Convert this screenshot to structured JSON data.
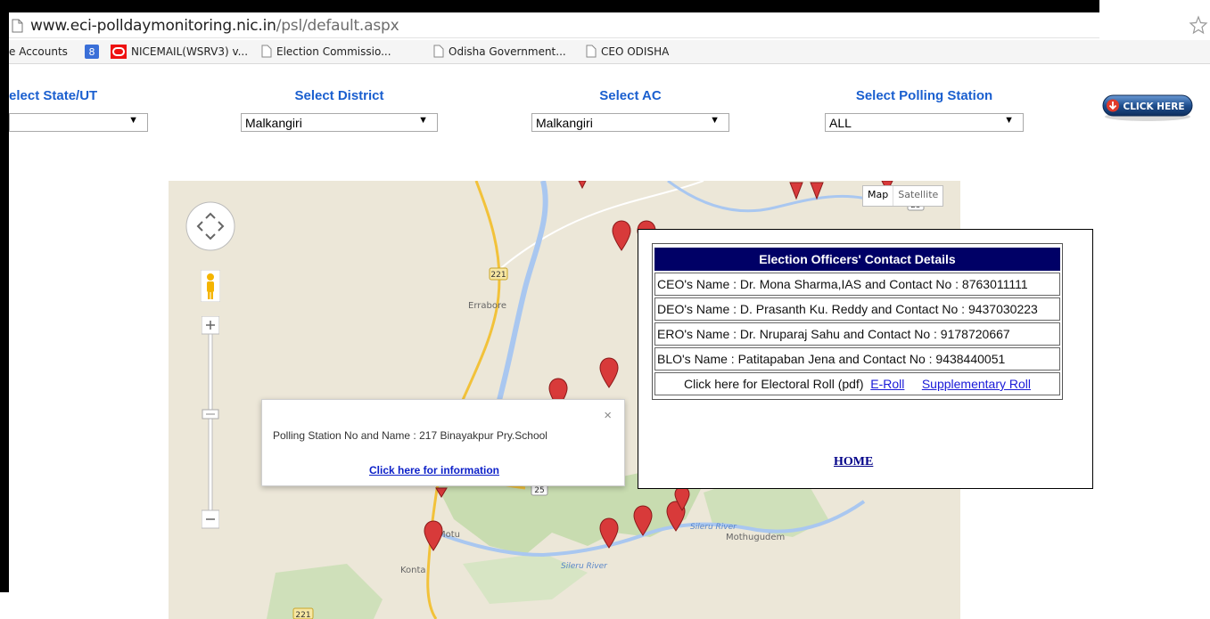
{
  "browser": {
    "url_host": "www.eci-polldaymonitoring.nic.in",
    "url_path": "/psl/default.aspx",
    "bookmarks": [
      {
        "label": "e Accounts"
      },
      {
        "label": "NICEMAIL(WSRV3) v..."
      },
      {
        "label": "Election Commissio..."
      },
      {
        "label": "Odisha Government..."
      },
      {
        "label": "CEO ODISHA"
      }
    ]
  },
  "filters": {
    "state": {
      "label": "elect State/UT",
      "value": ""
    },
    "district": {
      "label": "Select District",
      "value": "Malkangiri"
    },
    "ac": {
      "label": "Select AC",
      "value": "Malkangiri"
    },
    "polling_station": {
      "label": "Select Polling Station",
      "value": "ALL"
    }
  },
  "click_here_button": {
    "label": "CLICK HERE",
    "color": "#1f4f8f"
  },
  "map": {
    "type_options": [
      "Map",
      "Satellite"
    ],
    "places": [
      "Errabore",
      "Motu",
      "Konta",
      "Mothugudem"
    ],
    "rivers": [
      "Sileru River",
      "Sileru River"
    ],
    "road_numbers": [
      "221",
      "25",
      "25",
      "221"
    ],
    "marker_color": "#d83a3a"
  },
  "info_window": {
    "text": "Polling Station No and Name : 217 Binayakpur Pry.School",
    "link": "Click here for information",
    "close": "×"
  },
  "contact_panel": {
    "title": "Election Officers' Contact Details",
    "rows": [
      "CEO's Name : Dr. Mona Sharma,IAS and Contact No : 8763011111",
      "DEO's Name : D. Prasanth Ku. Reddy and Contact No : 9437030223",
      "ERO's Name : Dr. Nruparaj Sahu and Contact No : 9178720667",
      "BLO's Name : Patitapaban Jena and Contact No : 9438440051"
    ],
    "roll_text": "Click here for Electoral Roll (pdf)",
    "eroll_link": "E-Roll",
    "supplementary_link": "Supplementary Roll",
    "home_link": "HOME",
    "header_color": "#000066"
  }
}
